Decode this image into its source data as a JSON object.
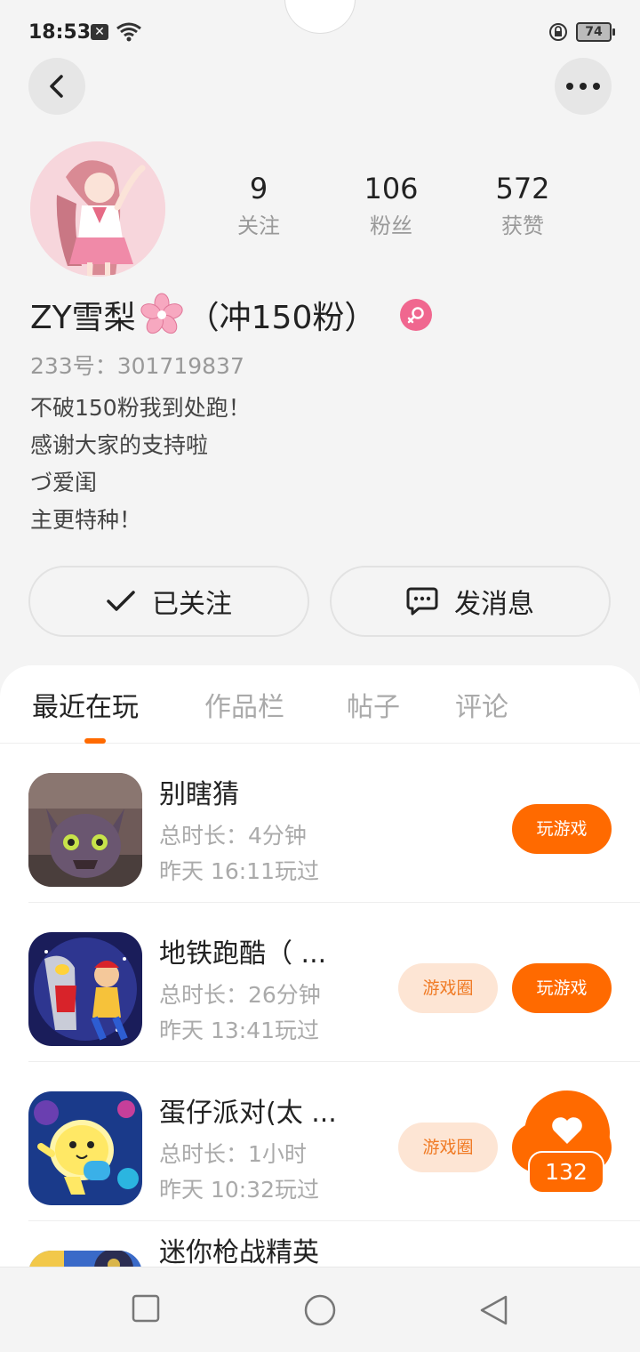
{
  "status_bar": {
    "time": "18:53",
    "battery": "74"
  },
  "profile": {
    "stats": [
      {
        "value": "9",
        "label": "关注"
      },
      {
        "value": "106",
        "label": "粉丝"
      },
      {
        "value": "572",
        "label": "获赞"
      }
    ],
    "nickname_prefix": "ZY雪梨",
    "nickname_suffix": "（冲150粉）",
    "uid": "233号：301719837",
    "bio_lines": [
      "不破150粉我到处跑！",
      "感谢大家的支持啦",
      "づ爱闺",
      "主更特种！"
    ]
  },
  "actions": {
    "follow_label": "已关注",
    "message_label": "发消息"
  },
  "tabs": [
    {
      "label": "最近在玩",
      "active": true
    },
    {
      "label": "作品栏",
      "active": false
    },
    {
      "label": "帖子",
      "active": false
    },
    {
      "label": "评论",
      "active": false
    }
  ],
  "games": [
    {
      "title": "别瞎猜",
      "duration": "总时长：4分钟",
      "last_played": "昨天 16:11玩过",
      "has_circle": false
    },
    {
      "title": "地铁跑酷（ ...",
      "duration": "总时长：26分钟",
      "last_played": "昨天 13:41玩过",
      "has_circle": true
    },
    {
      "title": "蛋仔派对(太 ...",
      "duration": "总时长：1小时",
      "last_played": "昨天 10:32玩过",
      "has_circle": true
    },
    {
      "title": "迷你枪战精英"
    }
  ],
  "buttons": {
    "play": "玩游戏",
    "circle": "游戏圈"
  },
  "like": {
    "count": "132"
  },
  "colors": {
    "accent": "#ff6a00",
    "circle_bg": "#fde5d4",
    "gender": "#f0678f"
  }
}
